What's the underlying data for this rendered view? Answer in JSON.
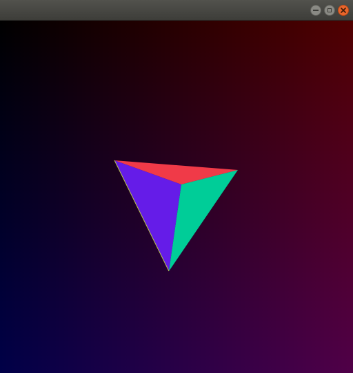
{
  "window": {
    "title": "",
    "controls": {
      "minimize_icon": "minimize-icon",
      "maximize_icon": "maximize-icon",
      "close_icon": "close-icon"
    }
  },
  "viewport": {
    "background": {
      "top_left": "#000000",
      "top_right": "#500000",
      "bottom_left": "#000048",
      "bottom_right": "#500048"
    },
    "object": {
      "type": "tetrahedron",
      "faces": [
        {
          "name": "top-face",
          "color": "#f03a48"
        },
        {
          "name": "left-face",
          "color": "#651ce8"
        },
        {
          "name": "right-face",
          "color": "#00cd98"
        }
      ]
    }
  }
}
